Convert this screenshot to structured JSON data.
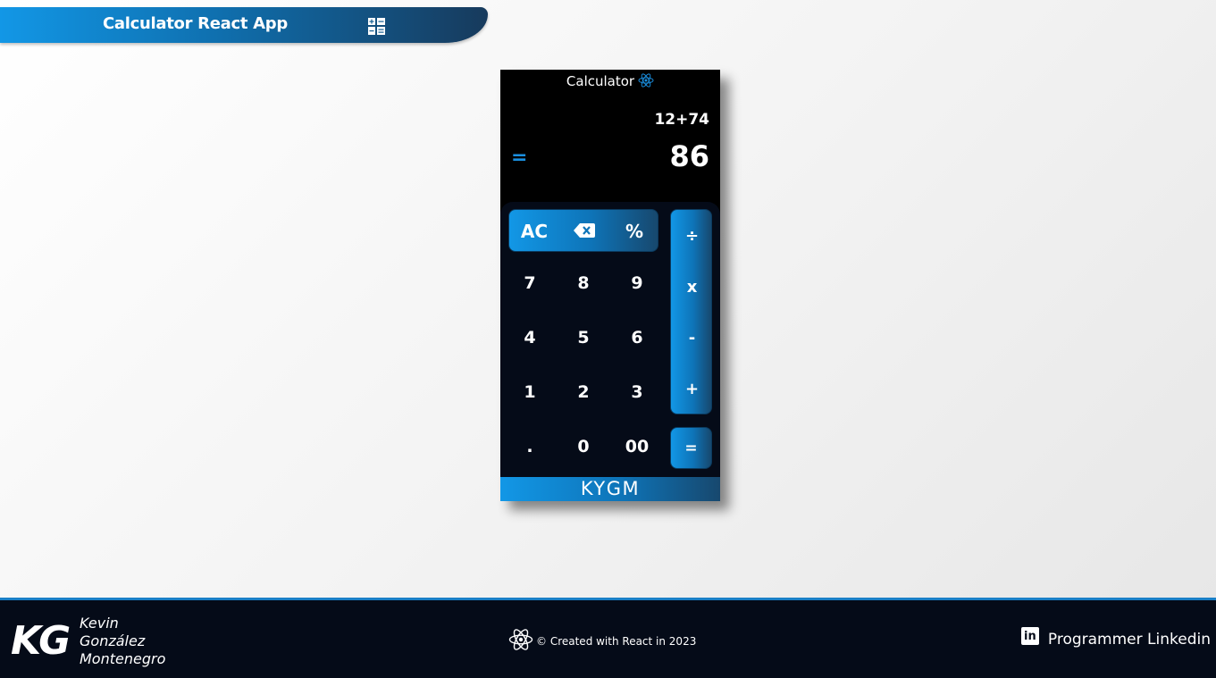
{
  "header": {
    "title": "Calculator React App",
    "icon": "calculator-icon"
  },
  "calculator": {
    "title": "Calculator",
    "title_icon": "react-icon",
    "expression": "12+74",
    "equals_sign": "=",
    "result": "86",
    "function_keys": [
      "AC",
      "⌫",
      "%"
    ],
    "digit_keys": [
      "7",
      "8",
      "9",
      "4",
      "5",
      "6",
      "1",
      "2",
      "3",
      ".",
      "0",
      "00"
    ],
    "operator_keys": [
      "÷",
      "x",
      "-",
      "+"
    ],
    "equals_key": "=",
    "brand": "KYGM"
  },
  "footer": {
    "logo": "KG",
    "author_name": "Kevin González Montenegro",
    "credit": "© Created with React in 2023",
    "linkedin_label": "Programmer Linkedin",
    "linkedin_icon_text": "in"
  },
  "colors": {
    "accent": "#1297e6",
    "dark": "#050b18"
  }
}
